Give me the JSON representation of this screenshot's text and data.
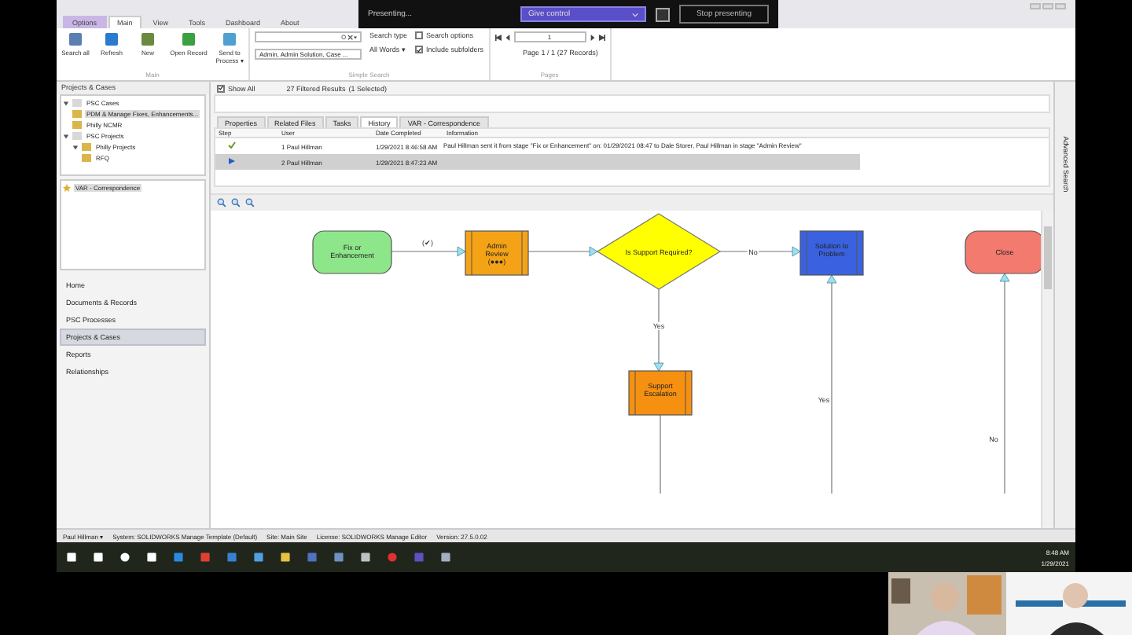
{
  "presenting": {
    "status": "Presenting...",
    "give_control": "Give control",
    "stop": "Stop presenting"
  },
  "ribbon_tabs": [
    {
      "label": "Options",
      "selected": false
    },
    {
      "label": "Main",
      "selected": true
    },
    {
      "label": "View",
      "selected": false
    },
    {
      "label": "Tools",
      "selected": false
    },
    {
      "label": "Dashboard",
      "selected": false
    },
    {
      "label": "About",
      "selected": false
    }
  ],
  "ribbon": {
    "main_buttons": [
      "Search all",
      "Refresh",
      "New",
      "Open Record",
      "Send to Process ▾"
    ],
    "main_group": "Main",
    "search_scope": "Admin, Admin Solution, Case ...",
    "search_type_label": "Search type",
    "search_type": "All Words ▾",
    "options": [
      {
        "label": "Search options",
        "checked": false
      },
      {
        "label": "Include subfolders",
        "checked": true
      }
    ],
    "search_group": "Simple Search",
    "page": "1",
    "page_info": "Page 1 / 1 (27 Records)",
    "pages_group": "Pages"
  },
  "left_panel": {
    "title": "Projects & Cases",
    "tree": [
      {
        "label": "PSC Cases",
        "expanded": true,
        "selected": false,
        "children": [
          {
            "label": "PDM & Manage Fixes, Enhancements...",
            "selected": true
          },
          {
            "label": "Philly NCMR",
            "selected": false
          }
        ]
      },
      {
        "label": "PSC Projects",
        "expanded": true,
        "selected": false,
        "children": [
          {
            "label": "Philly Projects",
            "expanded": true,
            "selected": false,
            "children": [
              {
                "label": "RFQ",
                "selected": false
              }
            ]
          }
        ]
      }
    ],
    "related": [
      {
        "label": "VAR - Correspondence",
        "selected": true
      }
    ],
    "nav": [
      {
        "label": "Home",
        "selected": false
      },
      {
        "label": "Documents & Records",
        "selected": false
      },
      {
        "label": "PSC Processes",
        "selected": false
      },
      {
        "label": "Projects & Cases",
        "selected": true
      },
      {
        "label": "Reports",
        "selected": false
      },
      {
        "label": "Relationships",
        "selected": false
      }
    ]
  },
  "results_bar": {
    "show_all": {
      "label": "Show All",
      "checked": true
    },
    "count": "27 Filtered Results",
    "selection": "(1 Selected)"
  },
  "detail_tabs": [
    {
      "label": "Properties",
      "selected": false
    },
    {
      "label": "Related Files",
      "selected": false
    },
    {
      "label": "Tasks",
      "selected": false
    },
    {
      "label": "History",
      "selected": true
    },
    {
      "label": "VAR - Correspondence",
      "selected": false
    }
  ],
  "history": {
    "columns": [
      "Step",
      "User",
      "Date Completed",
      "Information"
    ],
    "rows": [
      {
        "kind": "done",
        "step": "1",
        "user": "Paul Hillman",
        "date": "1/29/2021 8:46:58 AM",
        "info": "Paul Hillman sent it from stage \"Fix or Enhancement\" on: 01/29/2021 08:47 to  Dale Storer, Paul Hillman in stage \"Admin Review\"",
        "selected": false
      },
      {
        "kind": "current",
        "step": "2",
        "user": "Paul Hillman",
        "date": "1/29/2021 8:47:23 AM",
        "selected": true
      }
    ]
  },
  "diagram": {
    "nodes": [
      {
        "kind": "start",
        "label": "Fix or Enhancement",
        "color": "#8ee68a"
      },
      {
        "kind": "process",
        "label": "Admin Review",
        "sub": "(●●●)",
        "color": "#f5a316"
      },
      {
        "kind": "decision",
        "label": "Is Support Required?",
        "color": "#ffff00"
      },
      {
        "kind": "process",
        "label": "Solution to Problem",
        "color": "#3a62e0"
      },
      {
        "kind": "end",
        "label": "Close",
        "color": "#f27a6e"
      },
      {
        "kind": "process",
        "label": "Support Escalation",
        "color": "#f59010"
      }
    ],
    "edge_labels": [
      "(✔)",
      "No",
      "Yes",
      "Yes",
      "No"
    ]
  },
  "side_label": "Advanced Search",
  "status_bar": {
    "user": "Paul Hillman ▾",
    "items": [
      "System: SOLIDWORKS Manage Template (Default)",
      "Site: Main Site",
      "License: SOLIDWORKS Manage Editor",
      "Version: 27.5.0.02"
    ]
  },
  "taskbar": {
    "time": "8:48 AM",
    "date": "1/29/2021"
  }
}
